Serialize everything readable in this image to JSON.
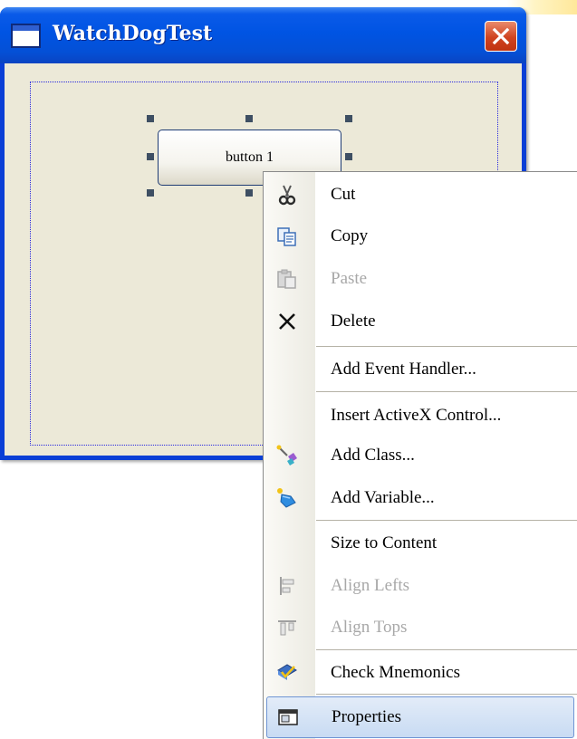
{
  "window": {
    "title": "WatchDogTest",
    "close_label": "Close"
  },
  "design_button": {
    "label": "button 1"
  },
  "context_menu": {
    "items": [
      {
        "label": "Cut",
        "icon": "scissors-icon",
        "enabled": true
      },
      {
        "label": "Copy",
        "icon": "copy-icon",
        "enabled": true
      },
      {
        "label": "Paste",
        "icon": "paste-icon",
        "enabled": false
      },
      {
        "label": "Delete",
        "icon": "delete-x-icon",
        "enabled": true
      },
      {
        "label": "Add Event Handler...",
        "icon": "",
        "enabled": true
      },
      {
        "label": "Insert ActiveX Control...",
        "icon": "",
        "enabled": true
      },
      {
        "label": "Add Class...",
        "icon": "add-class-wand-icon",
        "enabled": true
      },
      {
        "label": "Add Variable...",
        "icon": "add-variable-wand-icon",
        "enabled": true
      },
      {
        "label": "Size to Content",
        "icon": "",
        "enabled": true
      },
      {
        "label": "Align Lefts",
        "icon": "align-lefts-icon",
        "enabled": false
      },
      {
        "label": "Align Tops",
        "icon": "align-tops-icon",
        "enabled": false
      },
      {
        "label": "Check Mnemonics",
        "icon": "check-mnemonics-icon",
        "enabled": true
      },
      {
        "label": "Properties",
        "icon": "properties-icon",
        "enabled": true,
        "selected": true
      }
    ]
  },
  "colors": {
    "titlebar": "#0054e3",
    "client": "#ece9d8",
    "close_button": "#cf4320",
    "menu_highlight": "#c8dbf3",
    "disabled_text": "#a8a8a8"
  }
}
